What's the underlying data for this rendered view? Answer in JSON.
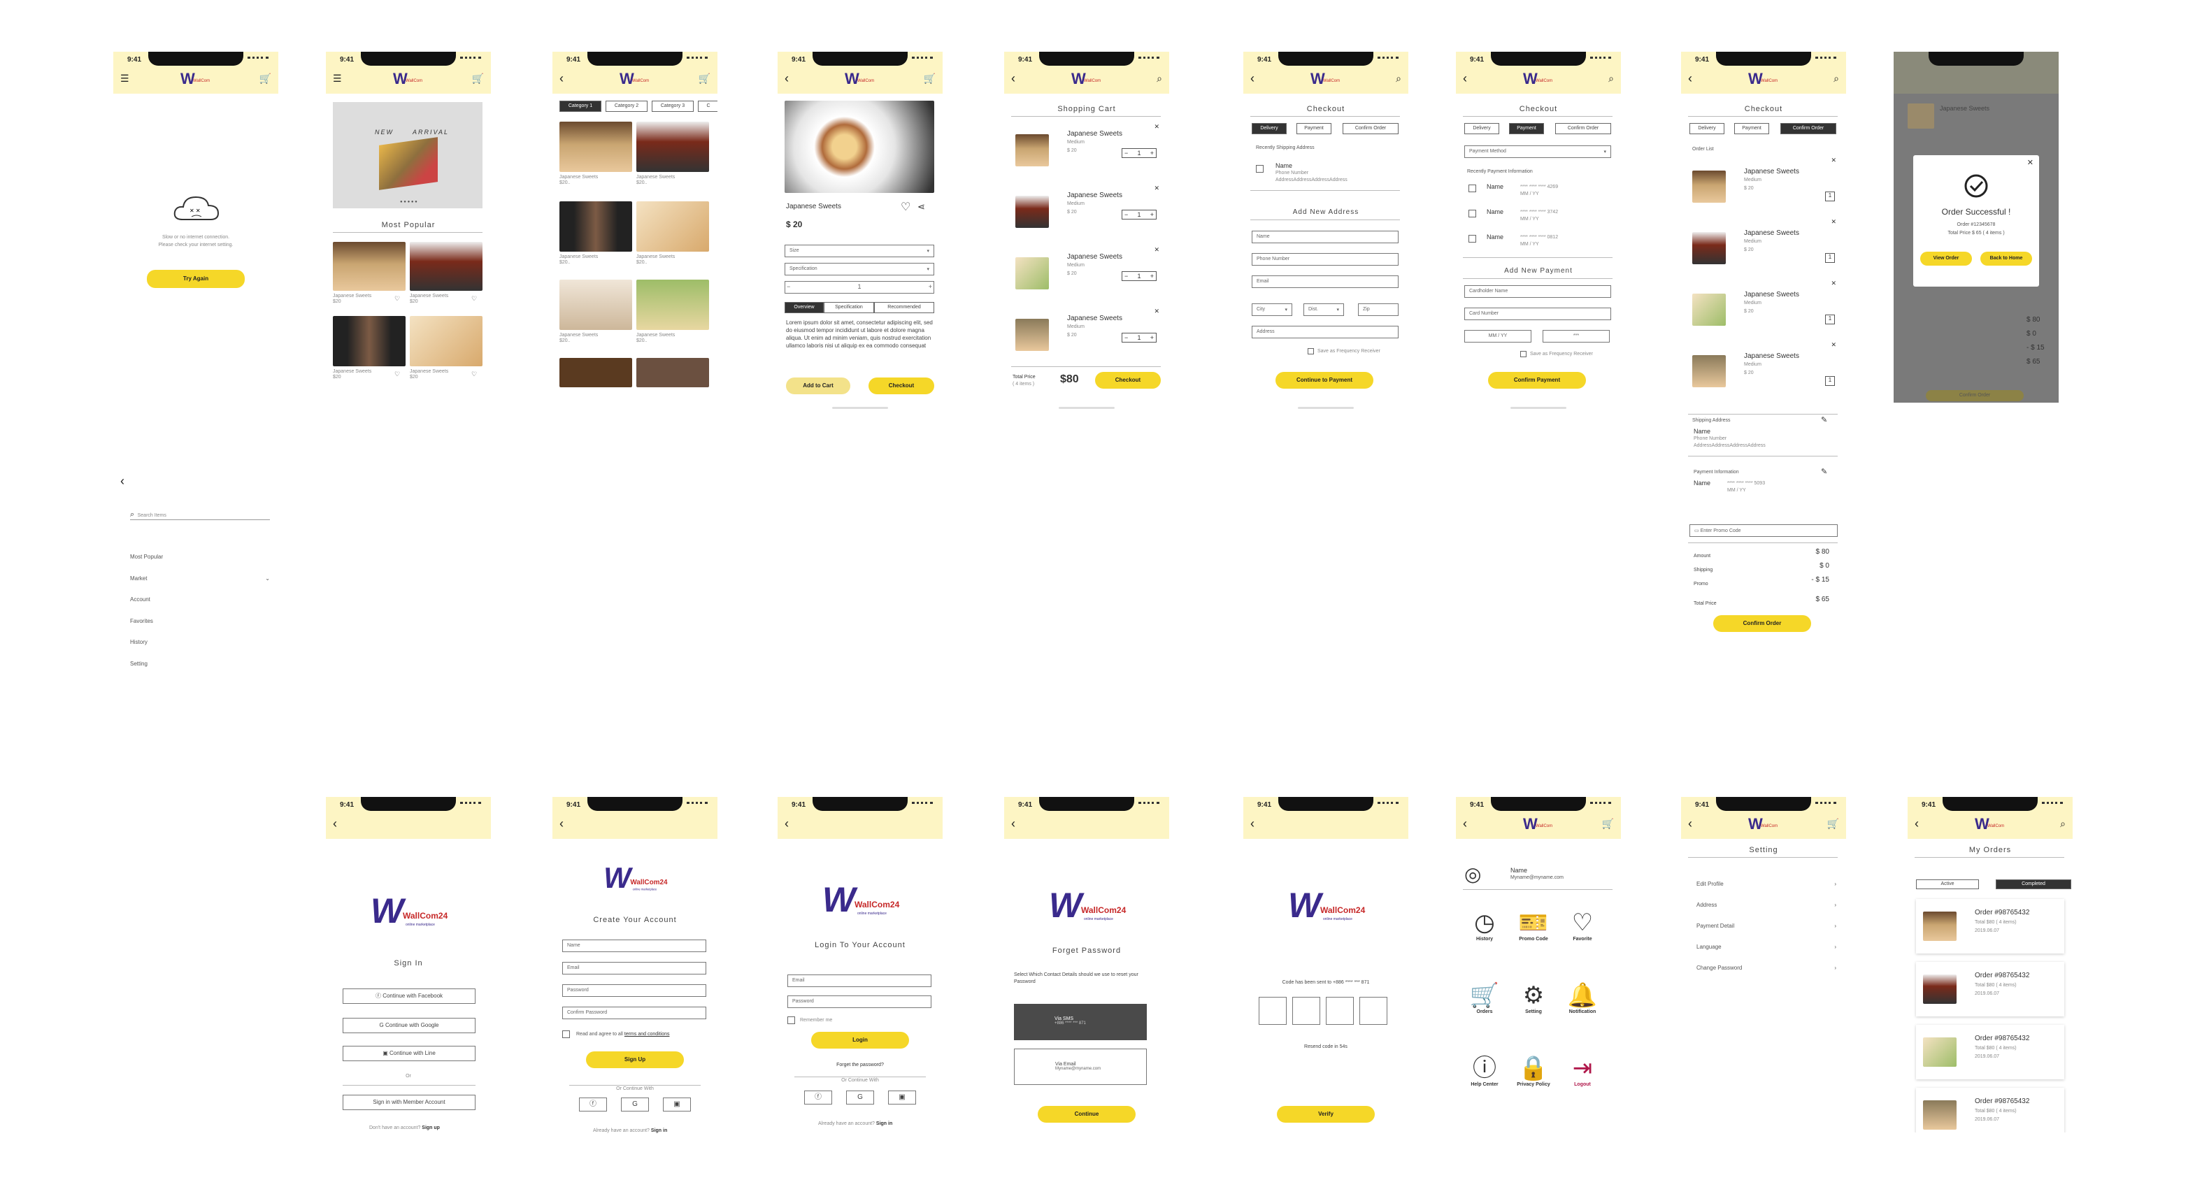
{
  "status_time": "9:41",
  "logo": {
    "text": "WallCom24",
    "sub": "online marketplace"
  },
  "product_name": "Japanese Sweets",
  "product_size": "Medium",
  "product_price_small": "$ 20",
  "offline": {
    "line1": "Slow or no internet connection.",
    "line2": "Please check your internet setting.",
    "button": "Try Again"
  },
  "menu": {
    "search_placeholder": "Search Items",
    "items": [
      "Most Popular",
      "Market",
      "Account",
      "Favorites",
      "History",
      "Setting"
    ]
  },
  "home": {
    "banner": [
      "NEW",
      "ARRIVAL"
    ],
    "section": "Most Popular",
    "price": "$20"
  },
  "categories": {
    "tabs": [
      "Category 1",
      "Category 2",
      "Category 3",
      "C"
    ],
    "price_short": "$20.."
  },
  "detail": {
    "name": "Japanese Sweets",
    "price": "$ 20",
    "selects": [
      "Size",
      "Specification"
    ],
    "qty": "1",
    "tabs": [
      "Overview",
      "Specification",
      "Recommended"
    ],
    "description": "Lorem ipsum dolor sit amet, consectetur adipiscing elit, sed do eiusmod tempor incididunt ut labore et dolore magna aliqua. Ut enim ad minim veniam, quis nostrud exercitation ullamco laboris nisi ut aliquip ex ea commodo consequat",
    "add_to_cart": "Add to Cart",
    "checkout": "Checkout"
  },
  "cart": {
    "title": "Shopping Cart",
    "qty": "1",
    "total_label": "Total Price",
    "total_items": "( 4 items )",
    "total": "$80",
    "checkout": "Checkout"
  },
  "checkout": {
    "title": "Checkout",
    "tabs": [
      "Delivery",
      "Payment",
      "Confirm Order"
    ],
    "recent_shipping": "Recently Shipping Address",
    "addr_name": "Name",
    "addr_phone": "Phone Number",
    "addr_text": "AddressAddressAddressAddress",
    "add_address": "Add New Address",
    "fields": [
      "Name",
      "Phone Number",
      "Email"
    ],
    "city": "City",
    "dist": "Dist.",
    "zip": "Zip",
    "address": "Address",
    "save_freq": "Save as Frequency Receiver",
    "continue": "Continue to Payment"
  },
  "payment": {
    "method": "Payment Method",
    "recent": "Recently Payment Information",
    "cards": [
      {
        "name": "Name",
        "num": "**** **** **** 4269",
        "exp": "MM / YY"
      },
      {
        "name": "Name",
        "num": "**** **** **** 3742",
        "exp": "MM / YY"
      },
      {
        "name": "Name",
        "num": "**** **** **** 0812",
        "exp": "MM / YY"
      }
    ],
    "add_payment": "Add New Payment",
    "cardholder": "Cardholder Name",
    "card_number": "Card Number",
    "mmyy": "MM / YY",
    "cvv": "***",
    "save_freq": "Save as Frequency Receiver",
    "confirm": "Confirm Payment"
  },
  "confirm": {
    "order_list": "Order List",
    "shipping_label": "Shipping Address",
    "name": "Name",
    "phone": "Phone Number",
    "addr": "AddressAddressAddressAddress",
    "payment_label": "Payment Information",
    "pay_name": "Name",
    "pay_num": "**** **** **** 5093",
    "pay_exp": "MM / YY",
    "promo": "Enter Promo Code",
    "rows": [
      {
        "label": "Amount",
        "value": "$ 80"
      },
      {
        "label": "Shipping",
        "value": "$ 0"
      },
      {
        "label": "Promo",
        "value": "- $ 15"
      },
      {
        "label": "Total Price",
        "value": "$ 65"
      }
    ],
    "button": "Confirm Order"
  },
  "success": {
    "title": "Order Successful !",
    "order": "Order #12345678",
    "total": "Total Price $ 65 ( 4 items )",
    "view": "View Order",
    "home": "Back to Home",
    "bg_values": [
      "$ 80",
      "$ 0",
      "- $ 15",
      "$ 65"
    ],
    "bg_button": "Confirm Order"
  },
  "signin": {
    "title": "Sign In",
    "facebook": "Continue with Facebook",
    "google": "Continue with Google",
    "line": "Continue with Line",
    "or": "Or",
    "member": "Sign in with Member Account",
    "no_account": "Don't have an account?",
    "signup": "Sign up"
  },
  "create": {
    "title": "Create Your Account",
    "fields": [
      "Name",
      "Email",
      "Password",
      "Confirm Password"
    ],
    "agree": "Read and agree to all",
    "terms": "terms and conditions",
    "button": "Sign Up",
    "or": "Or Continue With",
    "already": "Already have an account?",
    "signin": "Sign in"
  },
  "login": {
    "title": "Login To Your Account",
    "fields": [
      "Email",
      "Password"
    ],
    "remember": "Remember me",
    "button": "Login",
    "forgot": "Forget the password?",
    "or": "Or Continue With",
    "already": "Already have an account?",
    "signin": "Sign in"
  },
  "forgot": {
    "title": "Forget Password",
    "desc": "Select Which Contact Details should we use to reset your Password",
    "sms_label": "Via SMS",
    "sms_value": "+886 **** *** 871",
    "email_label": "Via Email",
    "email_value": "Myname@myname.com",
    "button": "Continue"
  },
  "verify": {
    "sent": "Code has been sent to +886 **** *** 871",
    "resend": "Resend code in 54s",
    "button": "Verify"
  },
  "account": {
    "name": "Name",
    "email": "Myname@myname.com",
    "icons": [
      {
        "label": "History",
        "glyph": "◷",
        "name": "history-icon"
      },
      {
        "label": "Promo Code",
        "glyph": "🎫",
        "name": "ticket-icon"
      },
      {
        "label": "Favorite",
        "glyph": "♡",
        "name": "heart-icon"
      },
      {
        "label": "Orders",
        "glyph": "🛒",
        "name": "cart-icon"
      },
      {
        "label": "Setting",
        "glyph": "⚙",
        "name": "gear-icon"
      },
      {
        "label": "Notification",
        "glyph": "🔔",
        "name": "bell-icon"
      },
      {
        "label": "Help Center",
        "glyph": "ⓘ",
        "name": "info-icon"
      },
      {
        "label": "Privacy Policy",
        "glyph": "🔒",
        "name": "lock-icon"
      },
      {
        "label": "Logout",
        "glyph": "⇥",
        "name": "logout-icon"
      }
    ]
  },
  "setting": {
    "title": "Setting",
    "items": [
      "Edit Profile",
      "Address",
      "Payment Detail",
      "Language",
      "Change Password"
    ]
  },
  "orders": {
    "title": "My Orders",
    "tabs": [
      "Active",
      "Completed"
    ],
    "order": "Order #98765432",
    "total": "Total $80 ( 4 items)",
    "date": "2019.06.07"
  },
  "colors": {
    "accent": "#f5d728",
    "header": "#fdf5c4",
    "dark": "#333333"
  }
}
